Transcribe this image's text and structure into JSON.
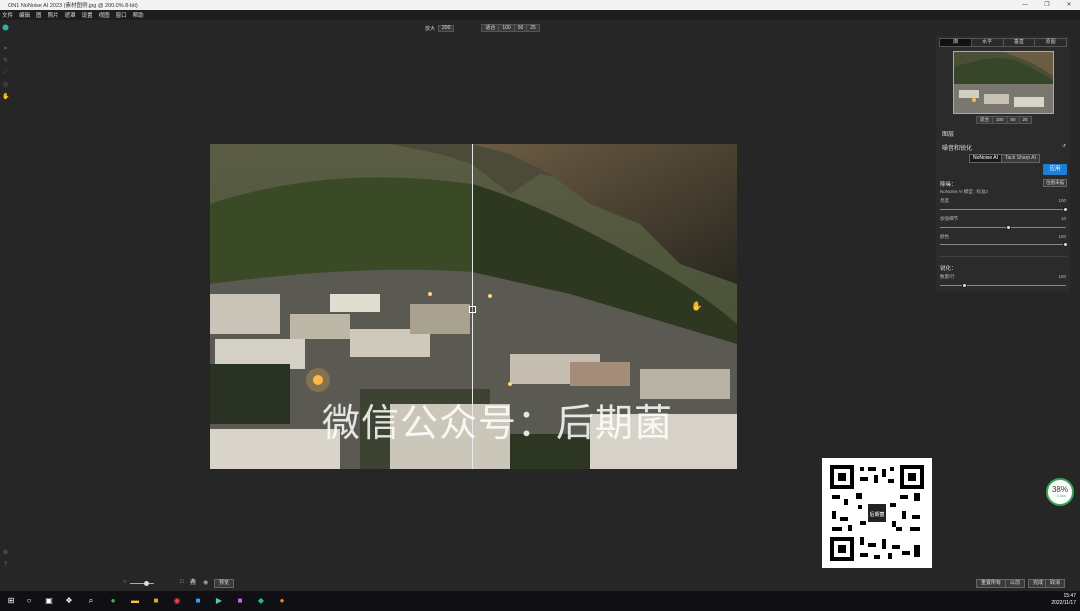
{
  "window": {
    "title": "ON1 NoNoise AI 2023 (素材图例.jpg @ 200.0% 8-bit)",
    "controls": [
      "—",
      "❐",
      "✕"
    ]
  },
  "menu": [
    "文件",
    "编辑",
    "图",
    "照片",
    "遮罩",
    "设置",
    "视图",
    "窗口",
    "帮助"
  ],
  "toolbar": {
    "zoom_label": "放大",
    "zoom_value": "200",
    "zoom_options": [
      "适合",
      "100",
      "50",
      "25"
    ]
  },
  "canvas": {
    "watermark": "微信公众号：后期菌"
  },
  "right_panel": {
    "tabs": [
      "浏",
      "水平",
      "垂直",
      "原图"
    ],
    "active_tab": 0,
    "nav_zoom_options": [
      "适合",
      "100",
      "50",
      "25"
    ],
    "section_label": "图层",
    "noise_title": "噪音和锐化",
    "models": [
      "NoNoise AI",
      "Tack Sharp AI"
    ],
    "apply_label": "应用",
    "noise_heading": "降噪：",
    "show_mask_label": "位图未描",
    "model_line": "NoNoise AI 模型  : 标准2",
    "sliders": [
      {
        "label": "亮度",
        "value": "100",
        "fraction": 1.0
      },
      {
        "label": "加强细节",
        "value": "10",
        "fraction": 0.55
      },
      {
        "label": "颜色",
        "value": "100",
        "fraction": 1.0
      }
    ],
    "sharpen_heading": "锐化：",
    "sharpen_slider": {
      "label": "数量/行",
      "value": "100",
      "fraction": 0.2
    }
  },
  "bottom_bar": {
    "zoom_fraction": 0.7,
    "preview_label": "预览",
    "reset_all": "重置所有",
    "cancel_small": "以前",
    "done": "完成",
    "cancel": "取消"
  },
  "overlay": {
    "qr_center_text": "后期菌",
    "badge_pct": "38%",
    "badge_sub": "↑ 0.1k/s"
  },
  "taskbar": {
    "time": "15:47",
    "date": "2022/11/17"
  }
}
